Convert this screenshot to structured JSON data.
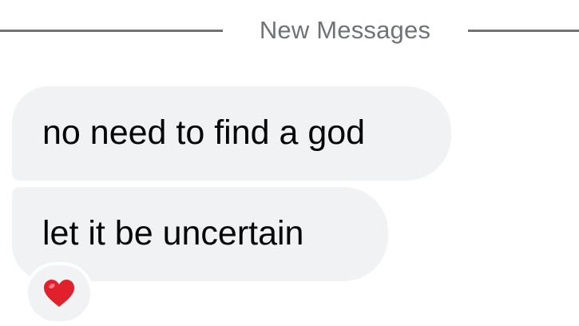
{
  "divider": {
    "label": "New Messages"
  },
  "messages": [
    {
      "text": "no need to find a god"
    },
    {
      "text": "let it be uncertain"
    }
  ],
  "reaction": {
    "icon": "heart-icon",
    "color": "#e0202b"
  },
  "colors": {
    "bubble": "#f1f2f4",
    "divider": "#6f7378",
    "text": "#050505"
  }
}
